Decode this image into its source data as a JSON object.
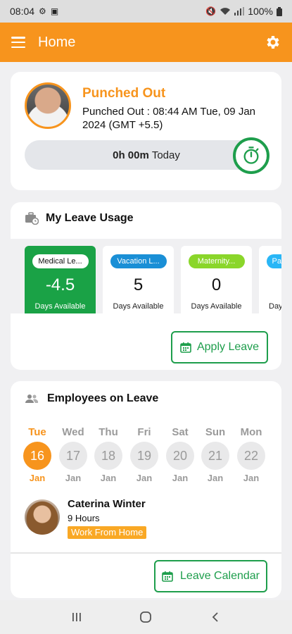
{
  "status_bar": {
    "time": "08:04",
    "battery": "100%"
  },
  "app_bar": {
    "title": "Home"
  },
  "punch": {
    "title": "Punched Out",
    "detail": "Punched Out : 08:44 AM Tue, 09 Jan 2024 (GMT +5.5)",
    "duration": "0h 00m",
    "period": "Today"
  },
  "leave_usage": {
    "title": "My Leave Usage",
    "tiles": [
      {
        "name": "Medical Le...",
        "value": "-4.5",
        "caption": "Days Available",
        "pill_color": "#ffffff",
        "highlight": true
      },
      {
        "name": "Vacation L...",
        "value": "5",
        "caption": "Days Available",
        "pill_color": "#1a8fd6"
      },
      {
        "name": "Maternity...",
        "value": "0",
        "caption": "Days Available",
        "pill_color": "#8ad62a"
      },
      {
        "name": "Pa",
        "value": "",
        "caption": "Day",
        "pill_color": "#29b6f6"
      }
    ],
    "apply_label": "Apply Leave"
  },
  "employees": {
    "title": "Employees on Leave",
    "days": [
      {
        "dow": "Tue",
        "date": "16",
        "mon": "Jan",
        "active": true
      },
      {
        "dow": "Wed",
        "date": "17",
        "mon": "Jan"
      },
      {
        "dow": "Thu",
        "date": "18",
        "mon": "Jan"
      },
      {
        "dow": "Fri",
        "date": "19",
        "mon": "Jan"
      },
      {
        "dow": "Sat",
        "date": "20",
        "mon": "Jan"
      },
      {
        "dow": "Sun",
        "date": "21",
        "mon": "Jan"
      },
      {
        "dow": "Mon",
        "date": "22",
        "mon": "Jan"
      }
    ],
    "person": {
      "name": "Caterina Winter",
      "hours": "9 Hours",
      "tag": "Work From Home"
    },
    "calendar_label": "Leave Calendar"
  },
  "colors": {
    "brand": "#f7941d",
    "accent_green": "#1e9e4c"
  }
}
